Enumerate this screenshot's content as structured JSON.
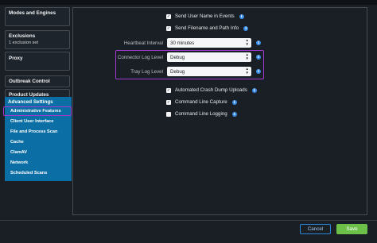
{
  "sidebar": {
    "modes": {
      "title": "Modes and Engines"
    },
    "exclusions": {
      "title": "Exclusions",
      "sub": "1 exclusion set"
    },
    "proxy": {
      "title": "Proxy"
    },
    "outbreak": {
      "title": "Outbreak Control"
    },
    "product_updates": {
      "title": "Product Updates"
    },
    "advanced": {
      "title": "Advanced Settings",
      "items": [
        "Administrative Features",
        "Client User Interface",
        "File and Process Scan",
        "Cache",
        "ClamAV",
        "Network",
        "Scheduled Scans"
      ]
    }
  },
  "main": {
    "send_user_name": {
      "label": "Send User Name in Events",
      "checked": true
    },
    "send_filename": {
      "label": "Send Filename and Path Info",
      "checked": true
    },
    "heartbeat": {
      "label": "Heartbeat Interval",
      "value": "30 minutes"
    },
    "connector_log": {
      "label": "Connector Log Level",
      "value": "Debug"
    },
    "tray_log": {
      "label": "Tray Log Level",
      "value": "Debug"
    },
    "crash_dump": {
      "label": "Automated Crash Dump Uploads",
      "checked": true
    },
    "cmd_capture": {
      "label": "Command Line Capture",
      "checked": true
    },
    "cmd_logging": {
      "label": "Command Line Logging",
      "checked": false
    }
  },
  "footer": {
    "cancel": "Cancel",
    "save": "Save"
  },
  "icons": {
    "info": "i",
    "check": "✓"
  },
  "colors": {
    "accent_blue": "#0b6fa5",
    "highlight": "#a23ad1",
    "save_green": "#6cc04a",
    "info_blue": "#3a8ee8"
  }
}
